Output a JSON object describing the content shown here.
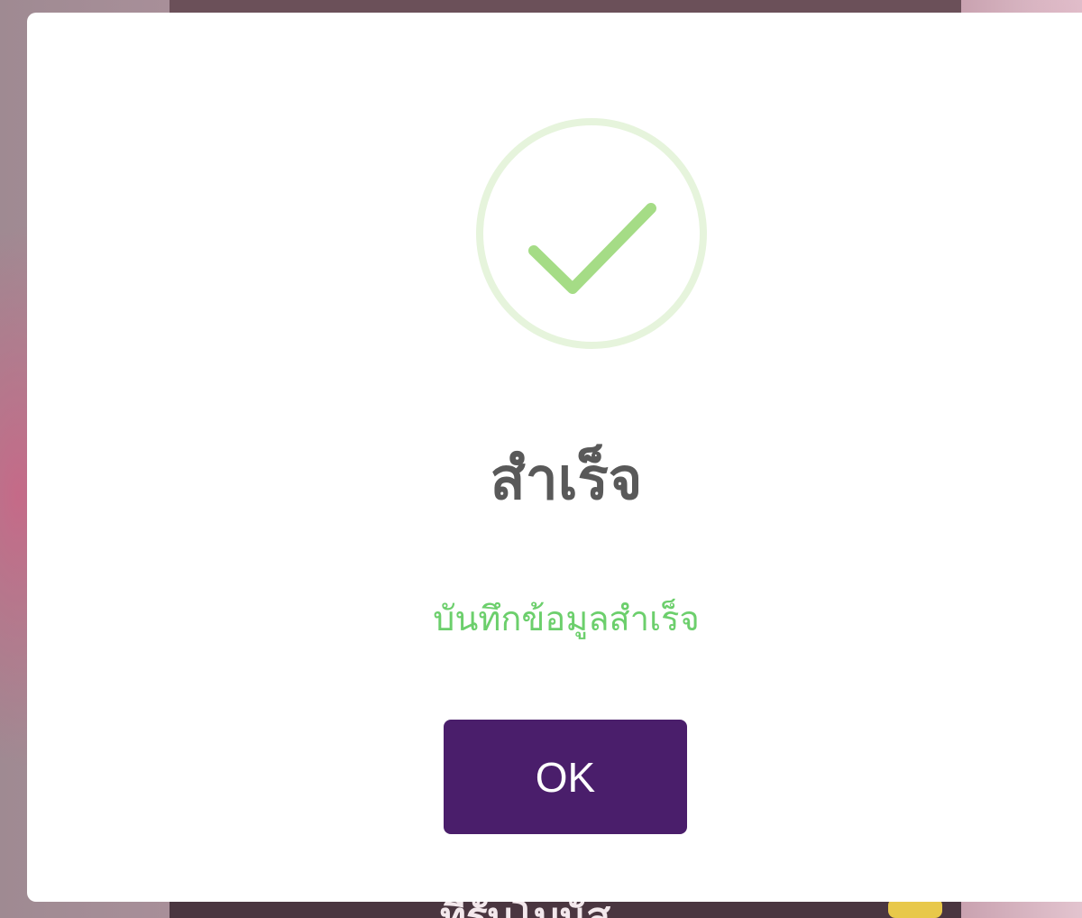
{
  "dialog": {
    "icon": "check-circle-icon",
    "title": "สำเร็จ",
    "message": "บันทึกข้อมูลสำเร็จ",
    "confirm_label": "OK"
  },
  "background": {
    "partial_text": "ที่รับโบนัส"
  },
  "colors": {
    "title": "#595959",
    "message": "#6ccf6c",
    "check": "#a5dc86",
    "ring": "#e6f4dc",
    "button": "#4a1e6b",
    "button_text": "#ffffff"
  }
}
